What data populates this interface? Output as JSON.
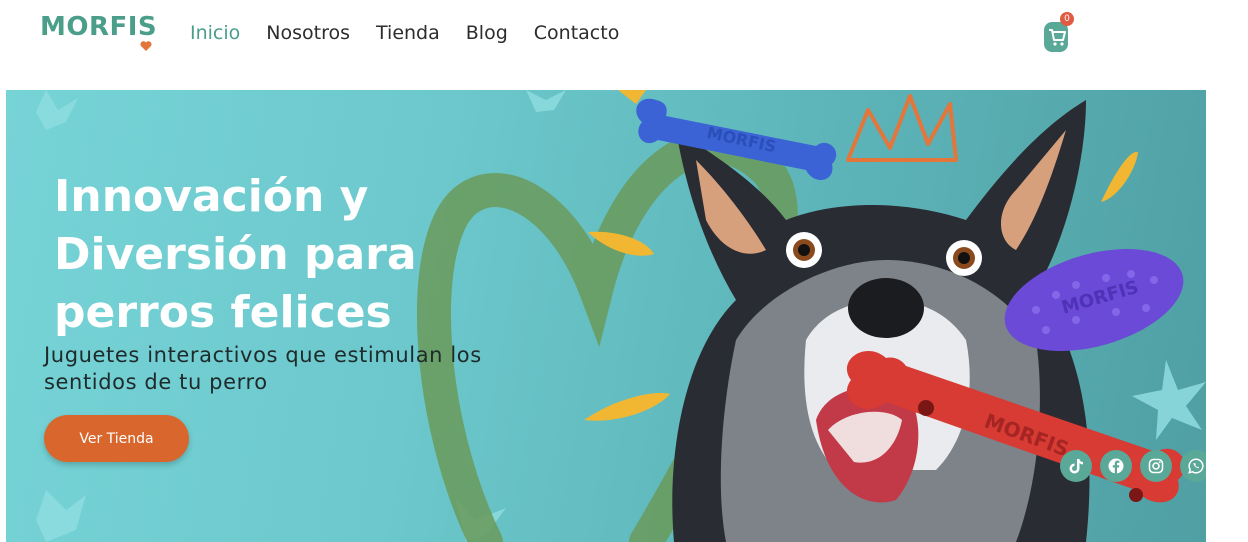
{
  "brand": {
    "logo_text": "MORFIS"
  },
  "nav": {
    "items": [
      {
        "label": "Inicio",
        "active": true
      },
      {
        "label": "Nosotros",
        "active": false
      },
      {
        "label": "Tienda",
        "active": false
      },
      {
        "label": "Blog",
        "active": false
      },
      {
        "label": "Contacto",
        "active": false
      }
    ]
  },
  "cart": {
    "count": "0",
    "icon": "cart-icon"
  },
  "hero": {
    "title_lines": [
      "Innovación y",
      "Diversión para",
      "perros felices"
    ],
    "subtitle_lines": [
      "Juguetes interactivos que estimulan los",
      "sentidos de tu perro"
    ],
    "cta_label": "Ver Tienda",
    "toy_brand": "MORFIS"
  },
  "social": [
    {
      "icon": "tiktok-icon"
    },
    {
      "icon": "facebook-icon"
    },
    {
      "icon": "instagram-icon"
    },
    {
      "icon": "whatsapp-icon"
    }
  ],
  "colors": {
    "brand_teal": "#4a9e8a",
    "accent_orange": "#d9672d",
    "hero_teal": "#6cc8cc",
    "text_dark": "#2d2d2d"
  }
}
